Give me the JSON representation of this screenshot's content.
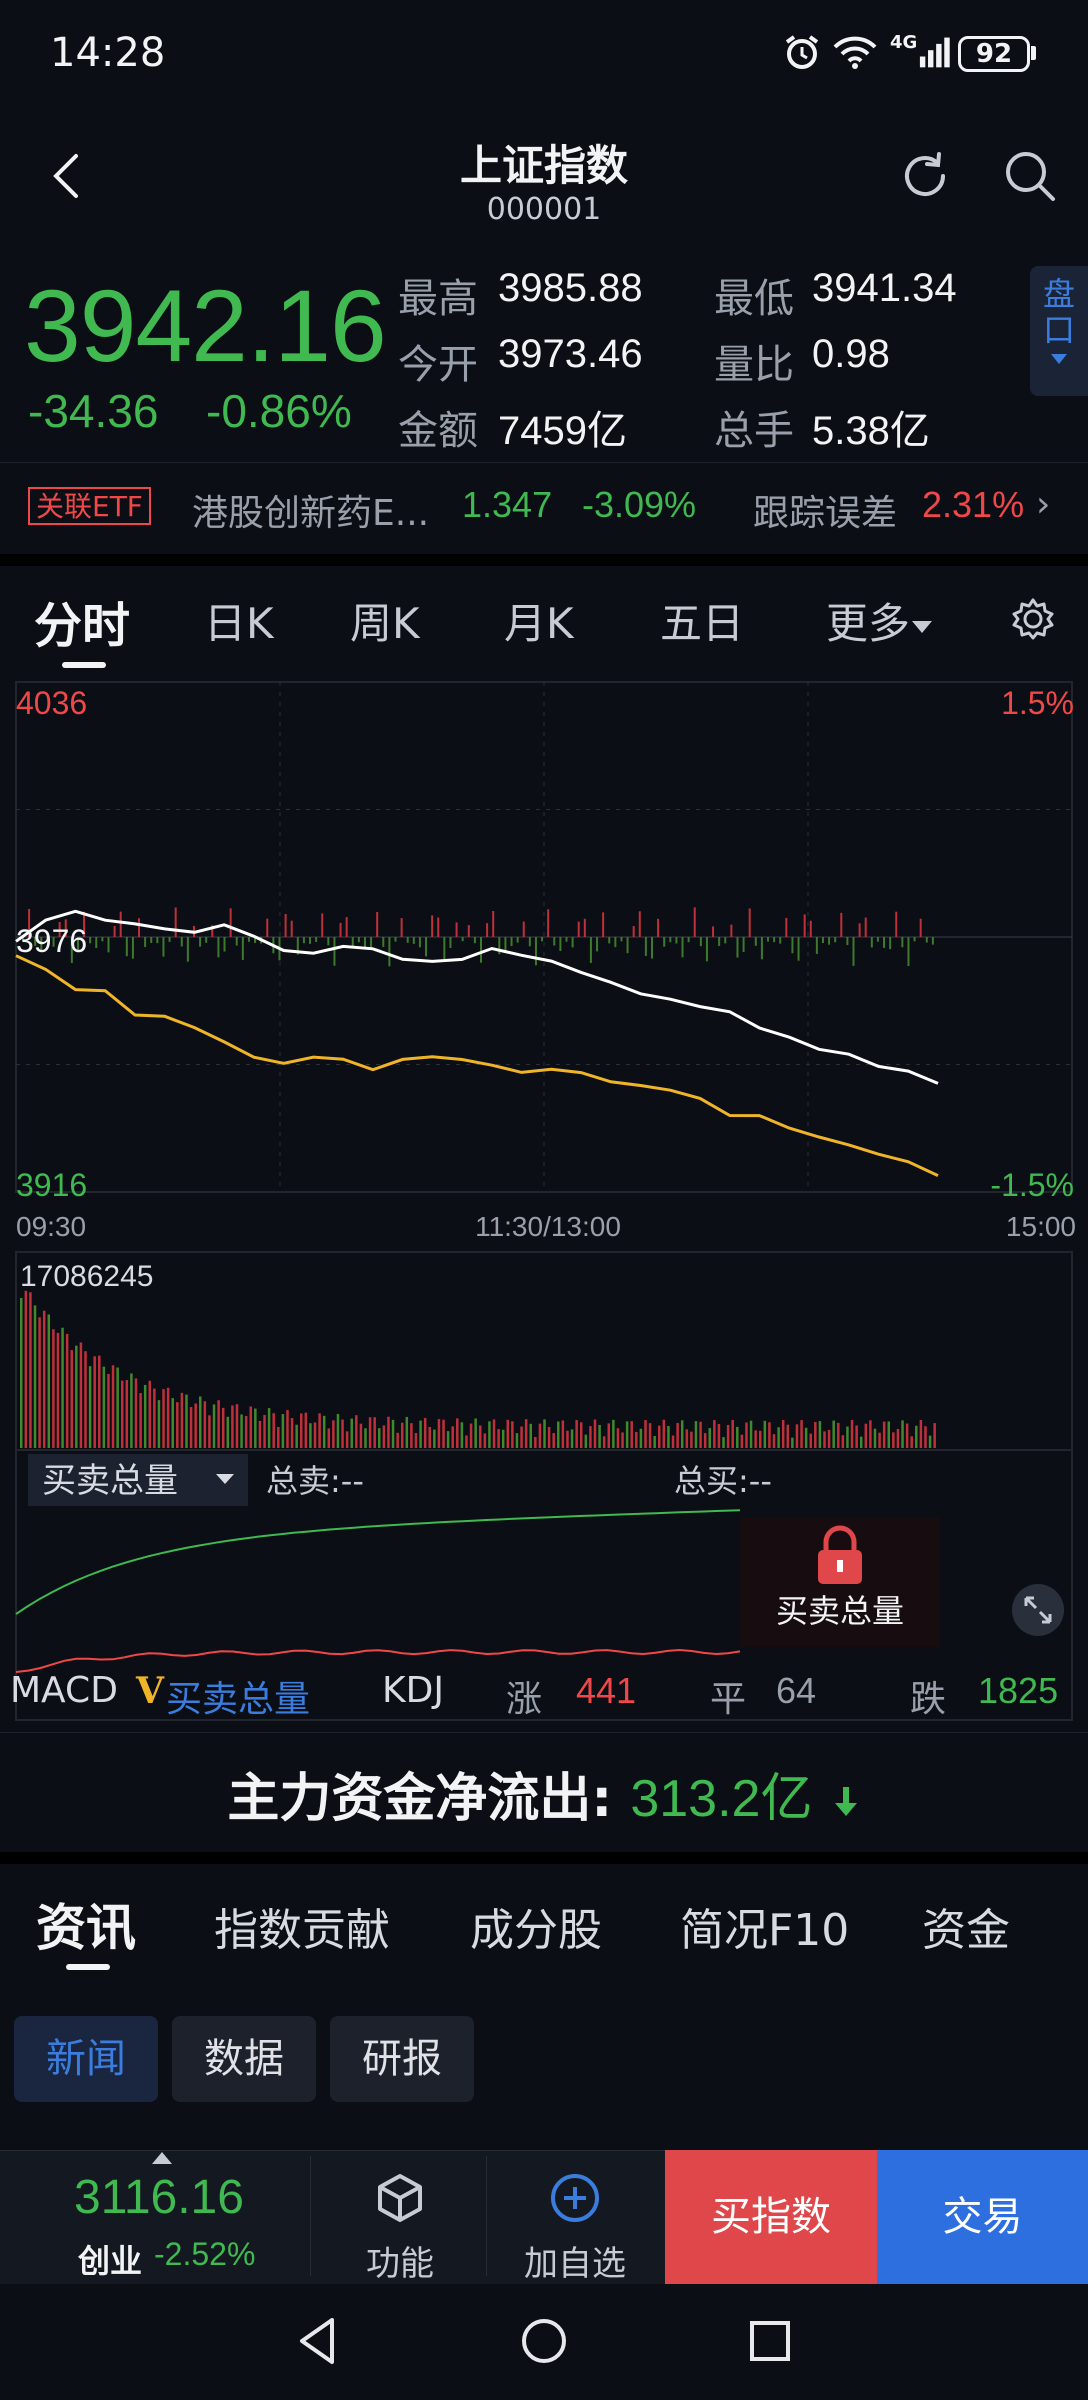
{
  "status_bar": {
    "time": "14:28",
    "battery": "92",
    "network": "4G"
  },
  "header": {
    "title": "上证指数",
    "code": "000001"
  },
  "quote": {
    "price": "3942.16",
    "change": "-34.36",
    "change_pct": "-0.86%",
    "stats": [
      {
        "label": "最高",
        "value": "3985.88",
        "color": "#f2f3f5"
      },
      {
        "label": "最低",
        "value": "3941.34",
        "color": "#f2f3f5"
      },
      {
        "label": "今开",
        "value": "3973.46",
        "color": "#f2f3f5"
      },
      {
        "label": "量比",
        "value": "0.98",
        "color": "#f2f3f5"
      },
      {
        "label": "金额",
        "value": "7459亿",
        "color": "#f2f3f5"
      },
      {
        "label": "总手",
        "value": "5.38亿",
        "color": "#f2f3f5"
      }
    ],
    "pankou_label": "盘口"
  },
  "etf": {
    "badge": "关联ETF",
    "name": "港股创新药E...",
    "price": "1.347",
    "change_pct": "-3.09%",
    "track_label": "跟踪误差",
    "track_value": "2.31%"
  },
  "chart_tabs": [
    "分时",
    "日K",
    "周K",
    "月K",
    "五日",
    "更多"
  ],
  "chart": {
    "price_top": "4036",
    "price_bottom": "3916",
    "price_ref": "3976",
    "pct_top": "1.5%",
    "pct_bottom": "-1.5%",
    "time_start": "09:30",
    "time_mid": "11:30/13:00",
    "time_end": "15:00",
    "volume_max": "17086245",
    "bs_selector": "买卖总量",
    "total_sell": "总卖:--",
    "total_buy": "总买:--",
    "locked_label": "买卖总量"
  },
  "chart_data": {
    "type": "line",
    "title": "",
    "x_range": [
      "09:30",
      "15:00"
    ],
    "ylim": [
      3916,
      4036
    ],
    "reference": 3976,
    "series": [
      {
        "name": "",
        "color": "#ffffff",
        "values": [
          3975,
          3980,
          3982,
          3980,
          3979,
          3978,
          3977,
          3979,
          3976,
          3973,
          3972,
          3974,
          3973,
          3971,
          3970,
          3971,
          3973,
          3972,
          3970,
          3968,
          3965,
          3963,
          3961,
          3960,
          3958,
          3955,
          3952,
          3950,
          3948,
          3946,
          3944,
          3942
        ]
      },
      {
        "name": "",
        "color": "#f0b429",
        "values": [
          3972,
          3968,
          3964,
          3963,
          3958,
          3957,
          3955,
          3951,
          3948,
          3946,
          3948,
          3947,
          3945,
          3947,
          3948,
          3947,
          3946,
          3944,
          3945,
          3944,
          3942,
          3941,
          3940,
          3938,
          3934,
          3934,
          3931,
          3929,
          3927,
          3925,
          3923,
          3920
        ]
      }
    ]
  },
  "indicators": {
    "macd": "MACD",
    "v_mark": "V",
    "bs_total": "买卖总量",
    "kdj": "KDJ",
    "up_label": "涨",
    "up_count": "441",
    "flat_label": "平",
    "flat_count": "64",
    "down_label": "跌",
    "down_count": "1825"
  },
  "flow": {
    "label": "主力资金净流出:",
    "value": "313.2亿"
  },
  "news_tabs": [
    "资讯",
    "指数贡献",
    "成分股",
    "简况F10",
    "资金"
  ],
  "news_chips": [
    "新闻",
    "数据",
    "研报"
  ],
  "toolbar": {
    "index_price": "3116.16",
    "index_name": "创业",
    "index_pct": "-2.52%",
    "function_label": "功能",
    "add_watch_label": "加自选",
    "buy_index_label": "买指数",
    "trade_label": "交易"
  }
}
